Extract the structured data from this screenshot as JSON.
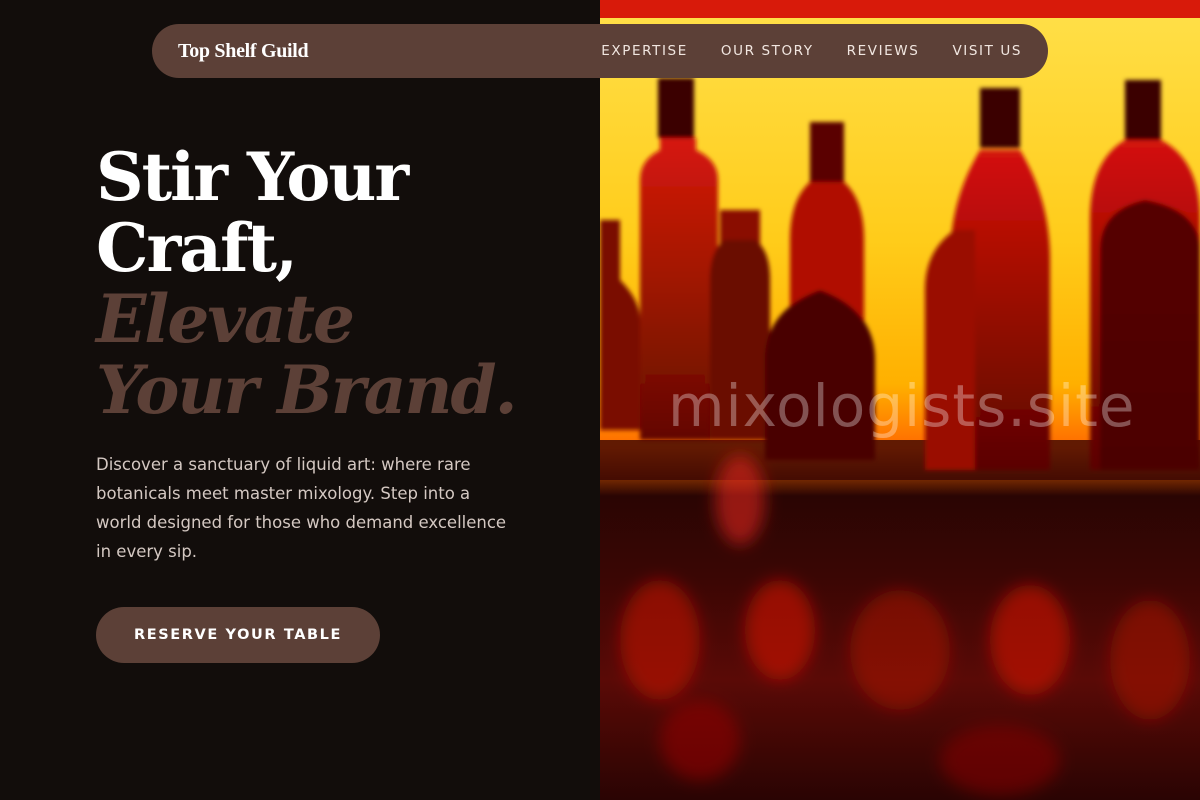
{
  "nav": {
    "brand": "Top Shelf Guild",
    "links": [
      "EXPERTISE",
      "OUR STORY",
      "REVIEWS",
      "VISIT US"
    ]
  },
  "hero": {
    "headline_line1": "Stir Your",
    "headline_line2": "Craft,",
    "headline_line3": "Elevate",
    "headline_line4": "Your Brand.",
    "description": "Discover a sanctuary of liquid art: where rare botanicals meet master mixology. Step into a world designed for those who demand excellence in every sip.",
    "cta_label": "RESERVE YOUR TABLE"
  },
  "watermark": "mixologists.site",
  "colors": {
    "background": "#120d0b",
    "accent": "#5c4037",
    "text_light": "#ffffff",
    "text_muted": "#d4c8c2"
  }
}
